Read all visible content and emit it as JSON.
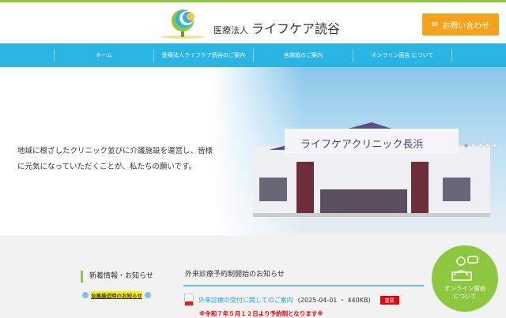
{
  "header": {
    "org_prefix": "医療法人",
    "org_name": "ライフケア読谷",
    "contact_label": "お問い合わせ"
  },
  "nav": [
    {
      "label": "ホーム"
    },
    {
      "label": "医療法人ライフケア読谷のご案内"
    },
    {
      "label": "各施設のご案内"
    },
    {
      "label": "オンライン面会 について"
    }
  ],
  "hero": {
    "text": "地域に根ざしたクリニック並びに介護施設を運営し、皆様に元気になっていただくことが、私たちの願いです。",
    "sign": "ライフケアクリニック長浜",
    "slides": 5,
    "active_slide": 1
  },
  "news": {
    "heading": "新着情報・お知らせ",
    "typhoon_link": "台風接近時のお知らせ",
    "article_title": "外来診療予約制開始のお知らせ",
    "file_link": "外来診療の受付に関してのご案内",
    "file_meta": "(2025-04-01 ・ 440KB)",
    "badge": "重要",
    "note": "※令和７年５月１２日より予約制となります※"
  },
  "online": {
    "label_line1": "オンライン面会",
    "label_line2": "について"
  },
  "colors": {
    "green": "#8dc63f",
    "blue": "#29b4e3",
    "orange": "#f6a21e",
    "red": "#ee0000"
  }
}
